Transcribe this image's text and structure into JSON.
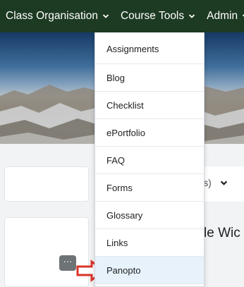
{
  "navbar": {
    "items": [
      {
        "label": "Class Organisation"
      },
      {
        "label": "Course Tools"
      },
      {
        "label": "Admin"
      }
    ]
  },
  "content": {
    "filter_label": "er(s)",
    "heading_fragment": "le Wic",
    "more_button_label": "···"
  },
  "dropdown": {
    "items": [
      {
        "label": "Assignments"
      },
      {
        "label": "Blog"
      },
      {
        "label": "Checklist"
      },
      {
        "label": "ePortfolio"
      },
      {
        "label": "FAQ"
      },
      {
        "label": "Forms"
      },
      {
        "label": "Glossary"
      },
      {
        "label": "Links"
      },
      {
        "label": "Panopto",
        "highlighted": true
      }
    ]
  },
  "annotation": {
    "arrow_color": "#d9342b"
  },
  "colors": {
    "navbar_bg": "#1d3a22",
    "highlight_bg": "#e7f2fb"
  }
}
